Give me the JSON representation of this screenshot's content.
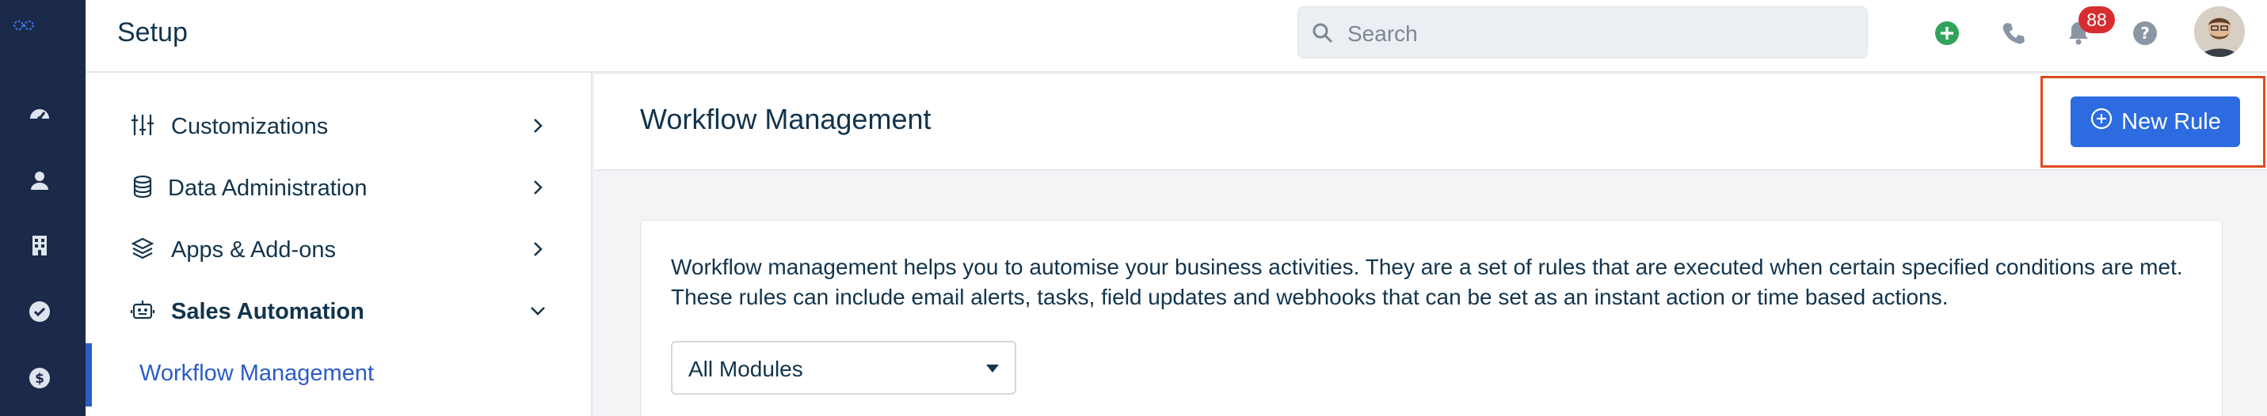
{
  "header": {
    "title": "Setup",
    "search_placeholder": "Search",
    "notification_count": "88"
  },
  "sidebar": {
    "items": [
      {
        "label": "Customizations",
        "icon": "sliders-icon",
        "state": "collapsed"
      },
      {
        "label": "Data Administration",
        "icon": "database-icon",
        "state": "collapsed"
      },
      {
        "label": "Apps & Add-ons",
        "icon": "layers-icon",
        "state": "collapsed"
      },
      {
        "label": "Sales Automation",
        "icon": "robot-icon",
        "state": "expanded"
      }
    ],
    "active_subitem": "Workflow Management"
  },
  "rail": {
    "icons": [
      "dashboard-icon",
      "contacts-icon",
      "accounts-icon",
      "tasks-icon",
      "deals-icon"
    ]
  },
  "main": {
    "title": "Workflow Management",
    "new_rule_label": "New Rule",
    "description": "Workflow management helps you to automise your business activities. They are a set of rules that are executed when certain specified conditions are met. These rules can include email alerts, tasks, field updates and webhooks that can be set as an instant action or time based actions.",
    "module_filter": "All Modules"
  },
  "colors": {
    "rail_bg": "#1b2a4a",
    "accent": "#2c6be0",
    "badge": "#d72d30",
    "highlight_border": "#e04a1f"
  }
}
